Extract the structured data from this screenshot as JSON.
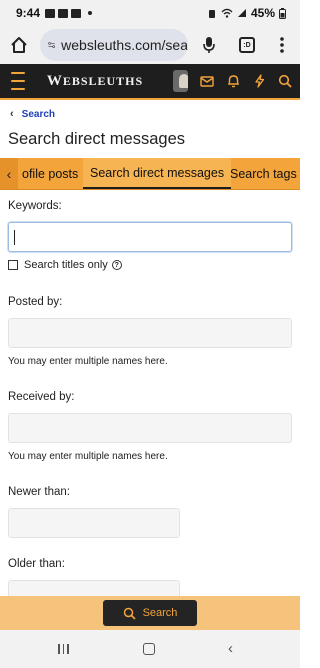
{
  "status_bar": {
    "time": "9:44",
    "battery": "45%"
  },
  "browser": {
    "url": "websleuths.com/sea",
    "tab_switcher_label": ":D"
  },
  "site": {
    "logo_first": "W",
    "logo_rest": "EBSLEUTHS",
    "accent_color": "#f3a43b",
    "header_color": "#1e1e1e"
  },
  "breadcrumb": {
    "label": "Search"
  },
  "page_title": "Search direct messages",
  "tabs": [
    {
      "label": "ofile posts",
      "active": false
    },
    {
      "label": "Search direct messages",
      "active": true
    },
    {
      "label": "Search tags",
      "active": false
    }
  ],
  "form": {
    "keywords_label": "Keywords:",
    "keywords_value": "",
    "titles_only_label": "Search titles only",
    "titles_only_checked": false,
    "posted_by_label": "Posted by:",
    "posted_by_hint": "You may enter multiple names here.",
    "received_by_label": "Received by:",
    "received_by_hint": "You may enter multiple names here.",
    "newer_than_label": "Newer than:",
    "older_than_label": "Older than:"
  },
  "search_button": {
    "label": "Search"
  }
}
